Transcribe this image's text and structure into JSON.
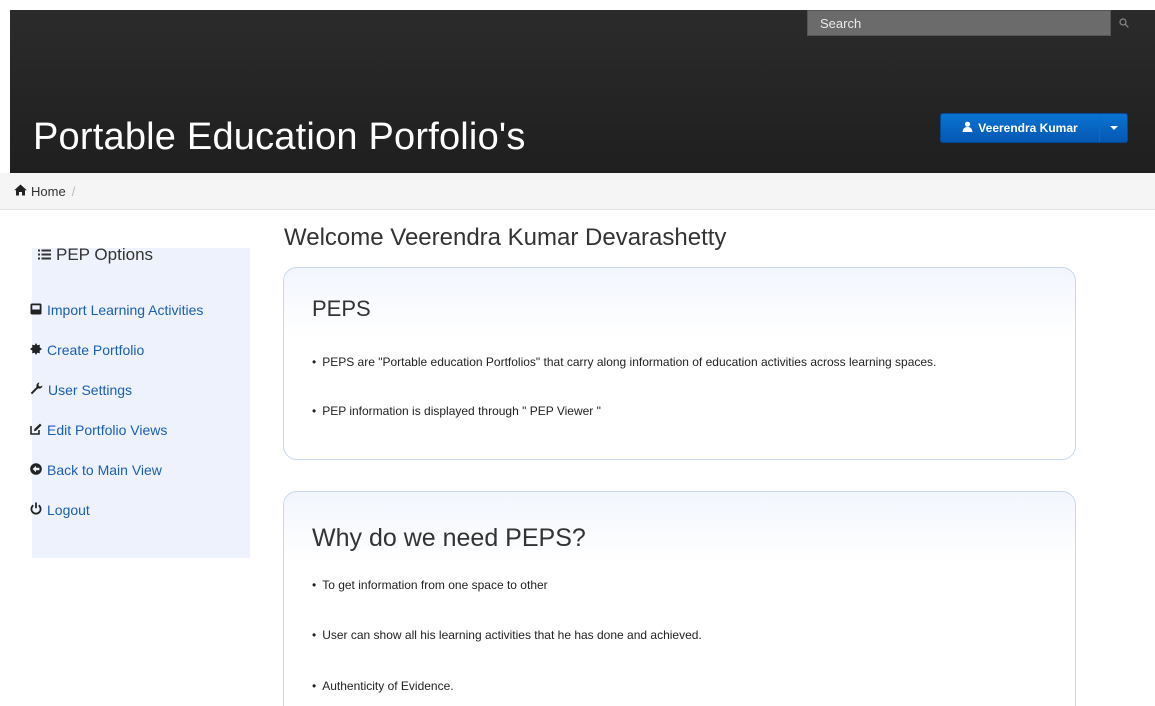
{
  "header": {
    "search_placeholder": "Search",
    "site_title": "Portable Education Porfolio's",
    "user_name": "Veerendra Kumar",
    "user_icon": "user-icon",
    "search_icon": "search-icon"
  },
  "breadcrumb": {
    "home_label": "Home",
    "separator": "/"
  },
  "sidebar": {
    "title": "PEP Options",
    "items": [
      {
        "label": "Import Learning Activities",
        "icon": "inbox-icon"
      },
      {
        "label": "Create Portfolio",
        "icon": "certificate-icon"
      },
      {
        "label": "User Settings",
        "icon": "wrench-icon"
      },
      {
        "label": "Edit Portfolio Views",
        "icon": "edit-icon"
      },
      {
        "label": "Back to Main View",
        "icon": "circle-arrow-left-icon"
      },
      {
        "label": "Logout",
        "icon": "power-icon"
      }
    ]
  },
  "main": {
    "welcome": "Welcome Veerendra Kumar Devarashetty",
    "panels": [
      {
        "title": "PEPS",
        "bullets": [
          "PEPS are \"Portable education Portfolios\" that carry along information of education activities across learning spaces.",
          "PEP information is displayed through \" PEP Viewer \""
        ]
      },
      {
        "title": "Why do we need PEPS?",
        "bullets": [
          "To get information from one space to other",
          "User can show all his learning activities that he has done and achieved.",
          "Authenticity of Evidence."
        ]
      }
    ]
  },
  "colors": {
    "header_bg": "#222222",
    "accent": "#0a6ad0",
    "link": "#1a5fb4",
    "sidebar_bg": "#eef2fc"
  }
}
